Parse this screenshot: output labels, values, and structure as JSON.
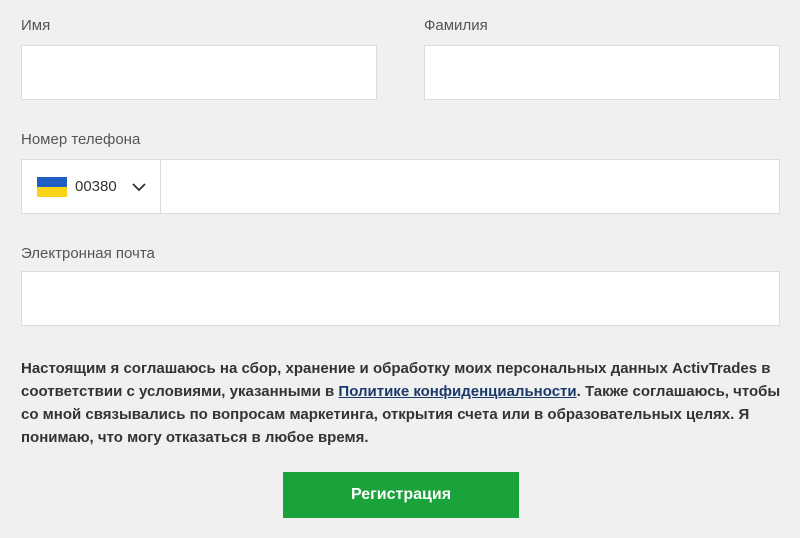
{
  "form": {
    "first_name_label": "Имя",
    "last_name_label": "Фамилия",
    "phone_label": "Номер телефона",
    "phone_country_code": "00380",
    "phone_country_flag": "ukraine-flag",
    "email_label": "Электронная почта",
    "first_name_value": "",
    "last_name_value": "",
    "phone_value": "",
    "email_value": ""
  },
  "consent": {
    "text_before": "Настоящим я соглашаюсь на сбор, хранение и обработку моих персональных данных ActivTrades в соответствии с условиями, указанными в ",
    "link_text": "Политике конфиденциальности",
    "text_after": ". Также соглашаюсь, чтобы со мной связывались по вопросам маркетинга, открытия счета или в образовательных целях. Я понимаю, что могу отказаться в любое время."
  },
  "submit_label": "Регистрация",
  "colors": {
    "background": "#f0f0f0",
    "button": "#1aa33a",
    "link": "#1a3a6b",
    "flag_blue": "#1f5fc4",
    "flag_yellow": "#f7d417"
  }
}
